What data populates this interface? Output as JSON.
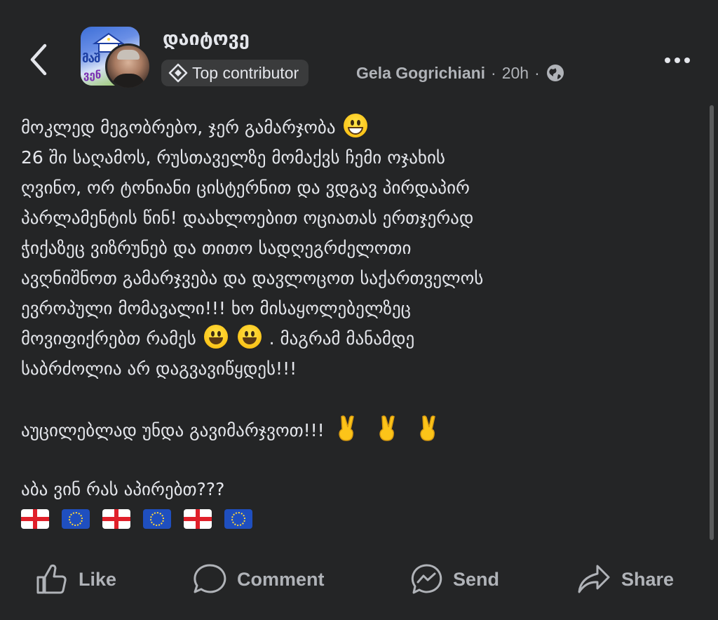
{
  "header": {
    "group_name": "დაიტოვე",
    "badge_label": "Top contributor",
    "author": "Gela Gogrichiani",
    "separator": "·",
    "time": "20h",
    "privacy_icon": "globe-icon",
    "back_icon": "chevron-left-icon",
    "more_icon": "more-horizontal-icon",
    "group_avatar_text": [
      "მაშ",
      "ვენ"
    ]
  },
  "post": {
    "paragraphs": {
      "p1": [
        "მოკლედ მეგობრებო, ჯერ გამარჯობა",
        "26 ში საღამოს, რუსთაველზე მომაქვს ჩემი ოჯახის",
        "ღვინო, ორ ტონიანი ცისტერნით და ვდგავ პირდაპირ",
        "პარლამენტის წინ!  დაახლოებით ოციათას ერთჯერად",
        "ჭიქაზეც ვიზრუნებ და თითო სადღეგრძელოთი",
        "ავღნიშნოთ გამარჯვება და დავლოცოთ საქართველოს",
        "ევროპული მომავალი!!! ხო მისაყოლებელზეც",
        "მოვიფიქრებთ რამეს",
        ". მაგრამ მანამდე",
        "საბრძოლია არ დაგვავიწყდეს!!!"
      ],
      "p2": "აუცილებლად უნდა გავიმარჯვოთ!!!",
      "p3": "აბა ვინ რას აპირებთ???"
    },
    "emojis": {
      "smile": "smiling-face",
      "grin": "grinning-face",
      "victory": "victory-hand"
    },
    "flags": [
      "georgia-flag",
      "eu-flag",
      "georgia-flag",
      "eu-flag",
      "georgia-flag",
      "eu-flag"
    ]
  },
  "actions": {
    "like": "Like",
    "comment": "Comment",
    "send": "Send",
    "share": "Share"
  },
  "colors": {
    "background": "#242526",
    "text": "#e4e6eb",
    "secondary_text": "#b0b3b8",
    "badge_bg": "#3a3b3c"
  }
}
